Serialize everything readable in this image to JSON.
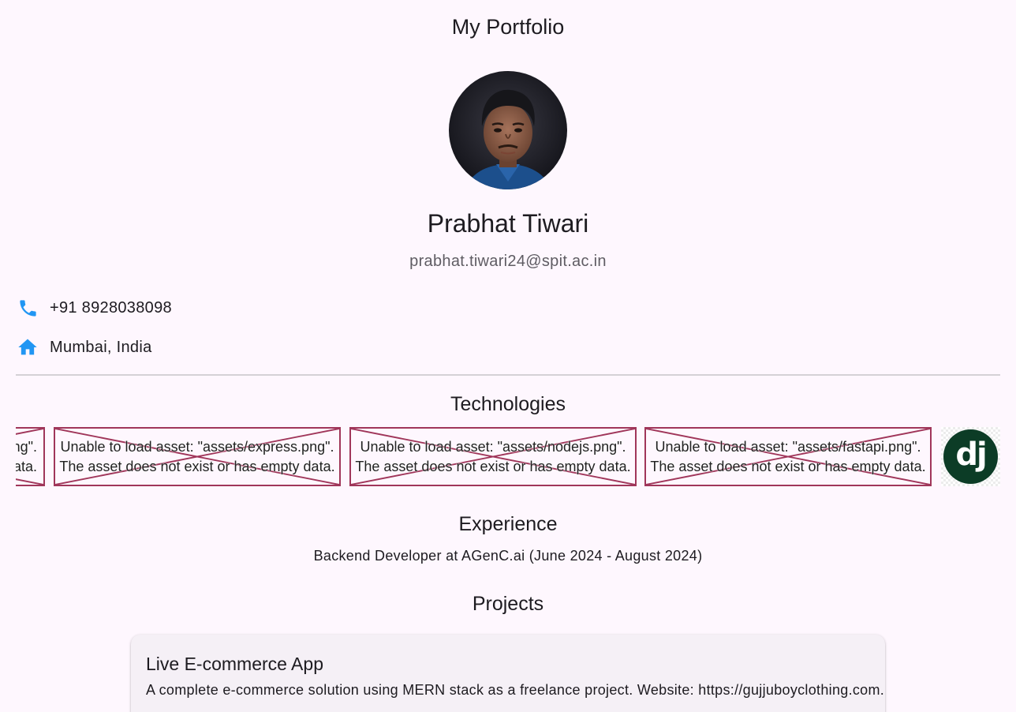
{
  "app": {
    "title": "My Portfolio"
  },
  "profile": {
    "name": "Prabhat Tiwari",
    "email": "prabhat.tiwari24@spit.ac.in",
    "phone": "+91 8928038098",
    "location": "Mumbai, India"
  },
  "technologies": {
    "title": "Technologies",
    "partial_error": {
      "line1": "ng\".",
      "line2": "ata."
    },
    "items": [
      {
        "line1": "Unable to load asset: \"assets/express.png\".",
        "line2": "The asset does not exist or has empty data."
      },
      {
        "line1": "Unable to load asset: \"assets/nodejs.png\".",
        "line2": "The asset does not exist or has empty data."
      },
      {
        "line1": "Unable to load asset: \"assets/fastapi.png\".",
        "line2": "The asset does not exist or has empty data."
      }
    ],
    "django_logo_text": "dj"
  },
  "experience": {
    "title": "Experience",
    "text": "Backend Developer at AGenC.ai (June 2024 - August 2024)"
  },
  "projects": {
    "title": "Projects",
    "items": [
      {
        "title": "Live E-commerce App",
        "description": "A complete e-commerce solution using MERN stack as a freelance project. Website: https://gujjuboyclothing.com."
      }
    ]
  },
  "colors": {
    "accent_icon": "#2196f3",
    "error_border": "#a0365a",
    "background": "#fef7fe"
  },
  "icons": {
    "phone": "phone-icon",
    "home": "home-icon"
  }
}
